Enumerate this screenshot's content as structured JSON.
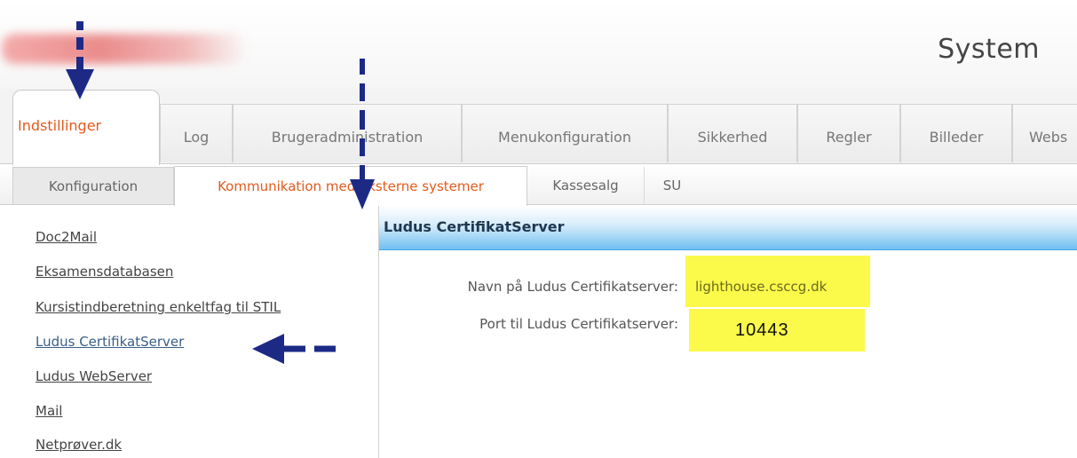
{
  "header": {
    "system_title": "System"
  },
  "main_tabs": [
    {
      "label": "Indstillinger",
      "active": true
    },
    {
      "label": "Log",
      "active": false
    },
    {
      "label": "Brugeradministration",
      "active": false
    },
    {
      "label": "Menukonfiguration",
      "active": false
    },
    {
      "label": "Sikkerhed",
      "active": false
    },
    {
      "label": "Regler",
      "active": false
    },
    {
      "label": "Billeder",
      "active": false
    },
    {
      "label": "Webs",
      "active": false
    }
  ],
  "sub_tabs": [
    {
      "label": "Konfiguration",
      "active": false
    },
    {
      "label": "Kommunikation med eksterne systemer",
      "active": true
    },
    {
      "label": "Kassesalg",
      "active": false
    },
    {
      "label": "SU",
      "active": false
    }
  ],
  "left_nav": [
    {
      "label": "Doc2Mail"
    },
    {
      "label": "Eksamensdatabasen"
    },
    {
      "label": "Kursistindberetning enkeltfag til STIL"
    },
    {
      "label": "Ludus CertifikatServer",
      "selected": true
    },
    {
      "label": "Ludus WebServer"
    },
    {
      "label": "Mail"
    },
    {
      "label": "Netprøver.dk"
    }
  ],
  "panel": {
    "title": "Ludus CertifikatServer",
    "fields": [
      {
        "label": "Navn på Ludus Certifikatserver:",
        "value": "lighthouse.csccg.dk"
      },
      {
        "label": "Port til Ludus Certifikatserver:",
        "value": "10443"
      }
    ]
  },
  "colors": {
    "active_tab_text": "#e25b1d",
    "highlight": "#fbf94a",
    "panel_header_blue": "#6fbff1",
    "annotation_arrow": "#1c2a86"
  },
  "icons": {
    "annotation_arrow_down": "arrow-down-icon",
    "annotation_arrow_left": "arrow-left-icon"
  }
}
